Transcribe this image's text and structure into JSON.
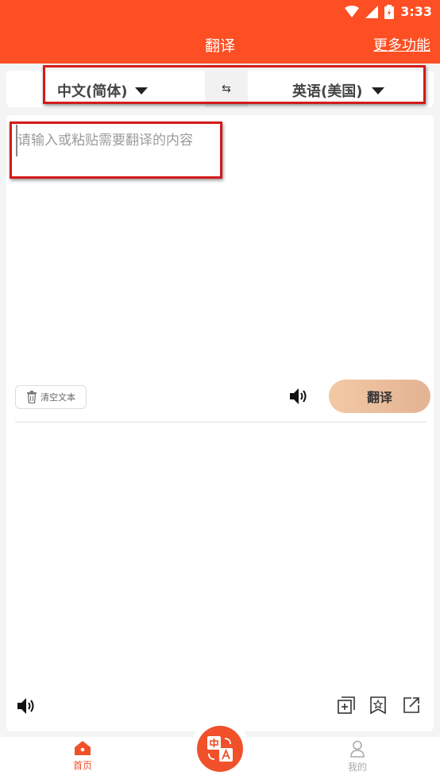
{
  "status_bar": {
    "time": "3:33"
  },
  "header": {
    "title": "翻译",
    "more_link": "更多功能"
  },
  "languages": {
    "source": "中文(简体)",
    "target": "英语(美国)",
    "swap_symbol": "⇆"
  },
  "input": {
    "value": "",
    "placeholder": "请输入或粘贴需要翻译的内容"
  },
  "actions": {
    "clear_label": "清空文本",
    "translate_label": "翻译"
  },
  "output": {
    "text": ""
  },
  "bottom_tools": {
    "icons": [
      "speaker-icon",
      "copy-add-icon",
      "bookmark-star-icon",
      "share-icon"
    ]
  },
  "tabbar": {
    "home_label": "首页",
    "center_icon": "translate-icon",
    "mine_label": "我的"
  },
  "colors": {
    "brand": "#fd4f23",
    "accent_tab": "#f0512a",
    "translate_button": "#f3c9a4",
    "highlight_box": "#d41a1a"
  }
}
